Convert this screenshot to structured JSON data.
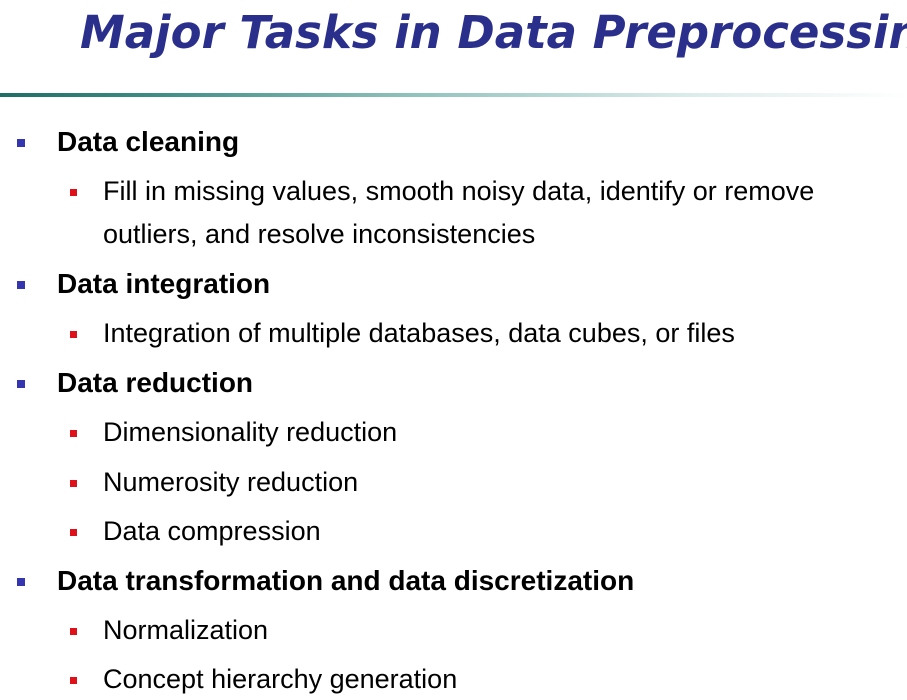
{
  "slide": {
    "title": "Major Tasks in Data Preprocessing",
    "items": [
      {
        "label": "Data cleaning",
        "subitems": [
          "Fill in missing values, smooth noisy data, identify or remove outliers, and resolve inconsistencies"
        ]
      },
      {
        "label": "Data integration",
        "subitems": [
          "Integration of multiple databases, data cubes, or files"
        ]
      },
      {
        "label": "Data reduction",
        "subitems": [
          "Dimensionality reduction",
          "Numerosity reduction",
          "Data compression"
        ]
      },
      {
        "label": "Data transformation and data discretization",
        "subitems": [
          "Normalization",
          "Concept hierarchy generation"
        ]
      }
    ]
  },
  "colors": {
    "title": "#2b2f8c",
    "level1_bullet": "#3535b0",
    "level2_bullet": "#e0101a",
    "divider": "#1e6e66"
  }
}
